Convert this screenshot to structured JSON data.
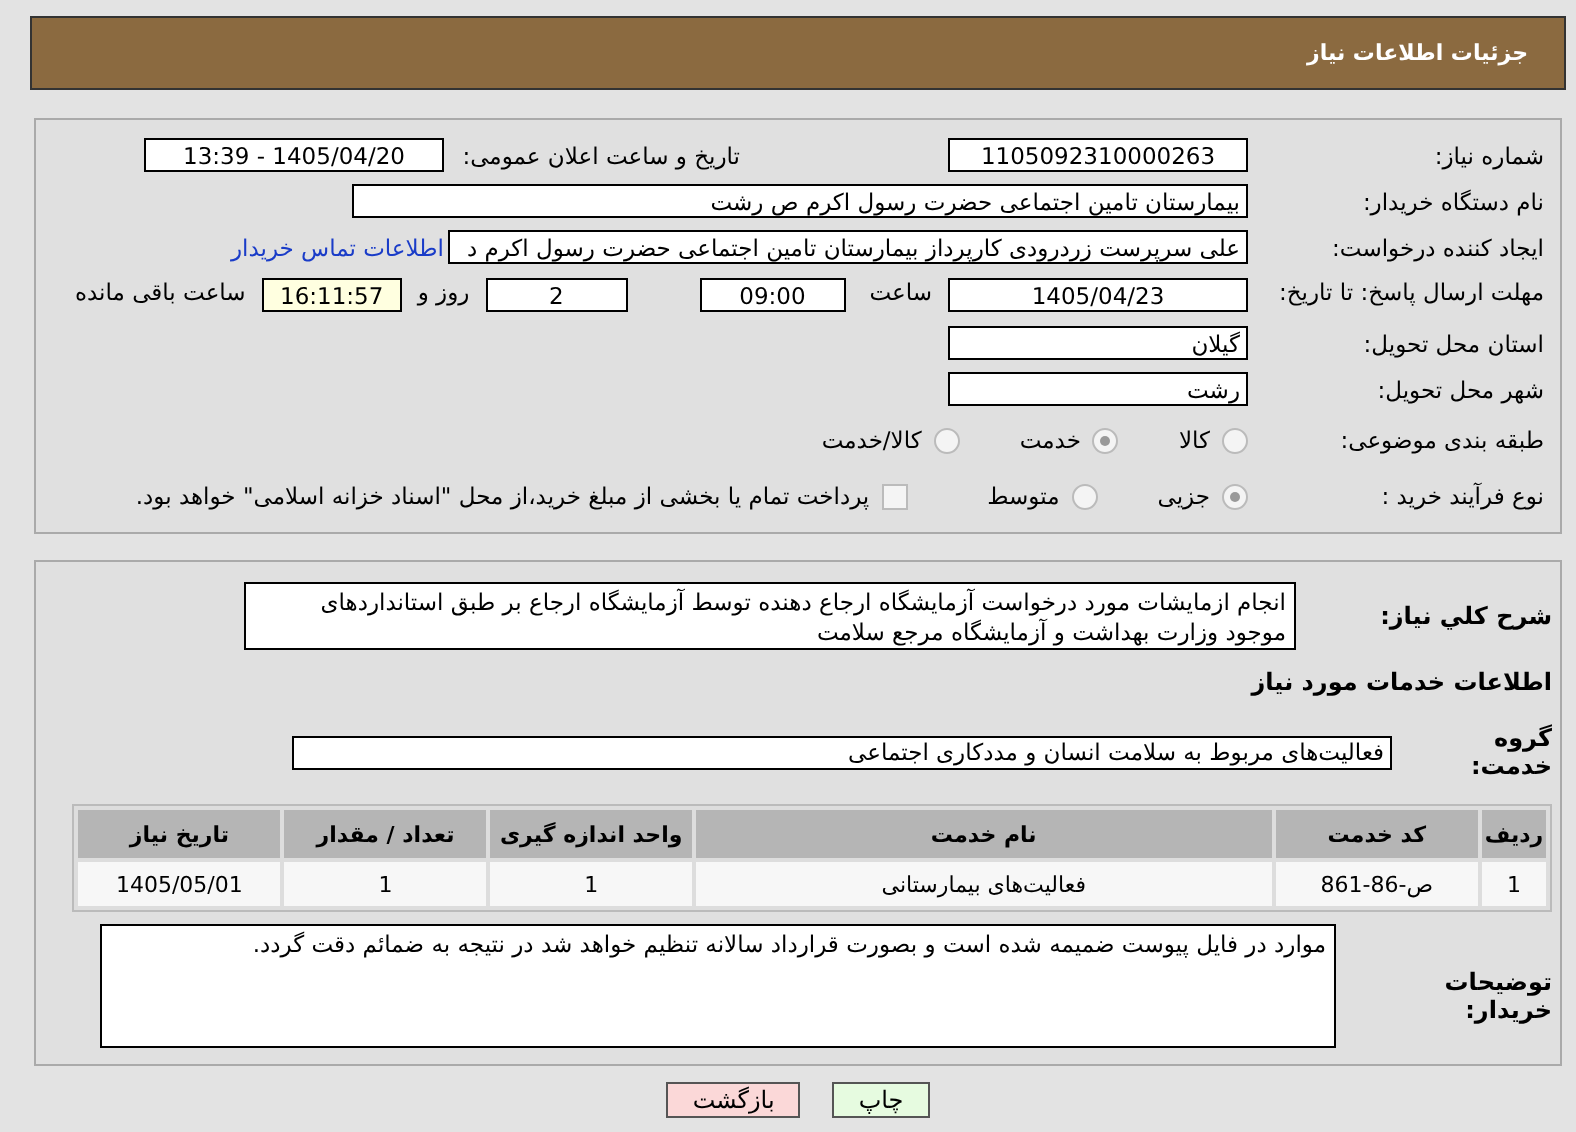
{
  "header": {
    "title": "جزئیات اطلاعات نیاز"
  },
  "need_number": {
    "label": "شماره نیاز:",
    "value": "1105092310000263"
  },
  "announce": {
    "label": "تاریخ و ساعت اعلان عمومی:",
    "value": "1405/04/20 - 13:39"
  },
  "buyer_org": {
    "label": "نام دستگاه خریدار:",
    "value": "بیمارستان  تامین اجتماعی حضرت رسول اکرم ص رشت"
  },
  "creator": {
    "label": "ایجاد کننده درخواست:",
    "value": "علی سرپرست زردرودی کارپرداز بیمارستان  تامین اجتماعی حضرت رسول اکرم د",
    "link": "اطلاعات تماس خریدار"
  },
  "deadline": {
    "label": "مهلت ارسال پاسخ: تا تاریخ:",
    "date": "1405/04/23",
    "time_label": "ساعت",
    "time": "09:00",
    "days": "2",
    "days_label": "روز و",
    "remaining": "16:11:57",
    "remaining_label": "ساعت باقی مانده"
  },
  "province": {
    "label": "استان محل تحویل:",
    "value": "گیلان"
  },
  "city": {
    "label": "شهر محل تحویل:",
    "value": "رشت"
  },
  "category": {
    "label": "طبقه بندی موضوعی:",
    "options": [
      {
        "label": "کالا",
        "selected": false
      },
      {
        "label": "خدمت",
        "selected": true
      },
      {
        "label": "کالا/خدمت",
        "selected": false
      }
    ]
  },
  "purchase_type": {
    "label": "نوع فرآیند خرید :",
    "options": [
      {
        "label": "جزیی",
        "selected": true
      },
      {
        "label": "متوسط",
        "selected": false
      }
    ],
    "payment_checkbox": {
      "checked": false,
      "label": "پرداخت تمام یا بخشی از مبلغ خرید،از محل \"اسناد خزانه اسلامی\" خواهد بود."
    }
  },
  "description": {
    "label": "شرح کلي نیاز:",
    "value": "انجام ازمایشات مورد درخواست آزمایشگاه ارجاع دهنده توسط آزمایشگاه ارجاع بر طبق استانداردهای موجود وزارت بهداشت و آزمایشگاه مرجع سلامت"
  },
  "services_heading": "اطلاعات خدمات مورد نیاز",
  "service_group": {
    "label": "گروه خدمت:",
    "value": "فعالیت‌های مربوط به سلامت انسان و مددکاری اجتماعی"
  },
  "table": {
    "columns": [
      "ردیف",
      "کد خدمت",
      "نام خدمت",
      "واحد اندازه گیری",
      "تعداد / مقدار",
      "تاریخ نیاز"
    ],
    "rows": [
      [
        "1",
        "ص-86-861",
        "فعالیت‌های بیمارستانی",
        "1",
        "1",
        "1405/05/01"
      ]
    ]
  },
  "buyer_notes": {
    "label": "توضیحات خریدار:",
    "value": "موارد در فایل پیوست ضمیمه شده است و بصورت قرارداد سالانه تنظیم خواهد شد در نتیجه به ضمائم دقت گردد."
  },
  "buttons": [
    {
      "kind": "print",
      "label": "چاپ"
    },
    {
      "kind": "back",
      "label": "بازگشت"
    }
  ]
}
